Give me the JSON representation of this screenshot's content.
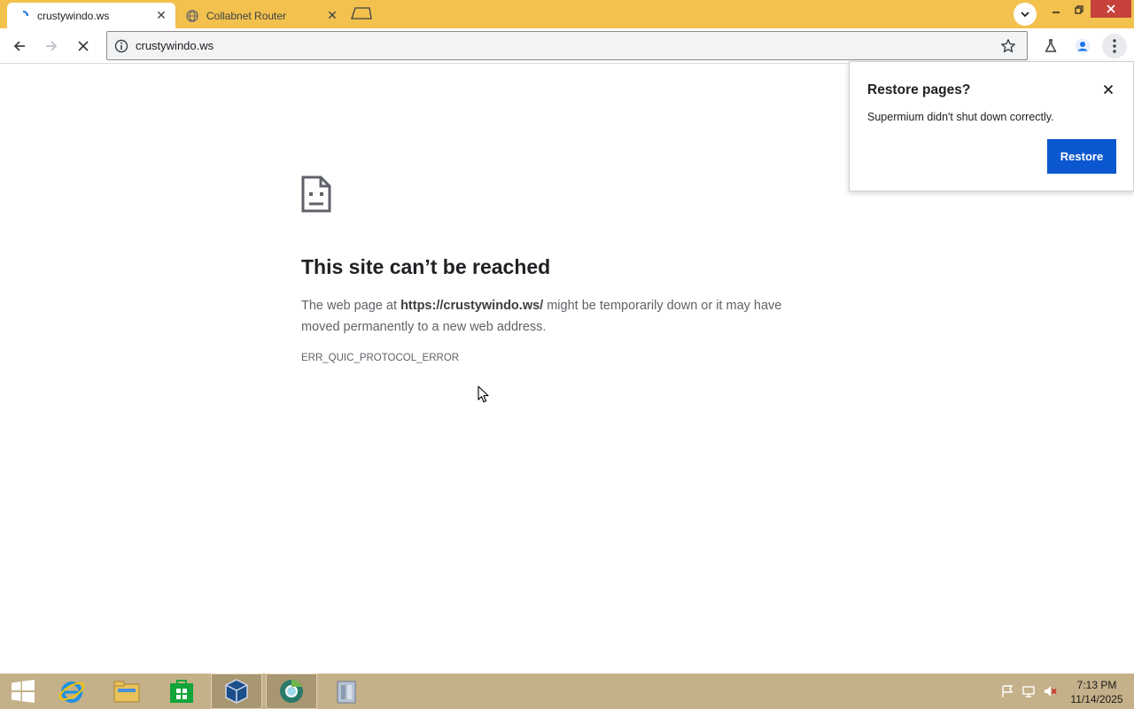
{
  "browser": {
    "tabs": [
      {
        "label": "crustywindo.ws",
        "active": true
      },
      {
        "label": "Collabnet Router",
        "active": false
      }
    ],
    "address": "crustywindo.ws"
  },
  "error_page": {
    "title": "This site can’t be reached",
    "desc_prefix": "The web page at ",
    "desc_url": "https://crustywindo.ws/",
    "desc_suffix": " might be temporarily down or it may have moved permanently to a new web address.",
    "code": "ERR_QUIC_PROTOCOL_ERROR"
  },
  "restore_bubble": {
    "title": "Restore pages?",
    "message": "Supermium didn't shut down correctly.",
    "button_label": "Restore"
  },
  "taskbar": {
    "items": [
      "start-button",
      "internet-explorer",
      "file-explorer",
      "store",
      "virtualbox",
      "supermium",
      "archive"
    ],
    "time": "7:13 PM",
    "date": "11/14/2025"
  },
  "colors": {
    "titlebar": "#f2c14e",
    "accent_button": "#0b57d0",
    "taskbar": "#c4b089",
    "close_button": "#c7423a"
  }
}
